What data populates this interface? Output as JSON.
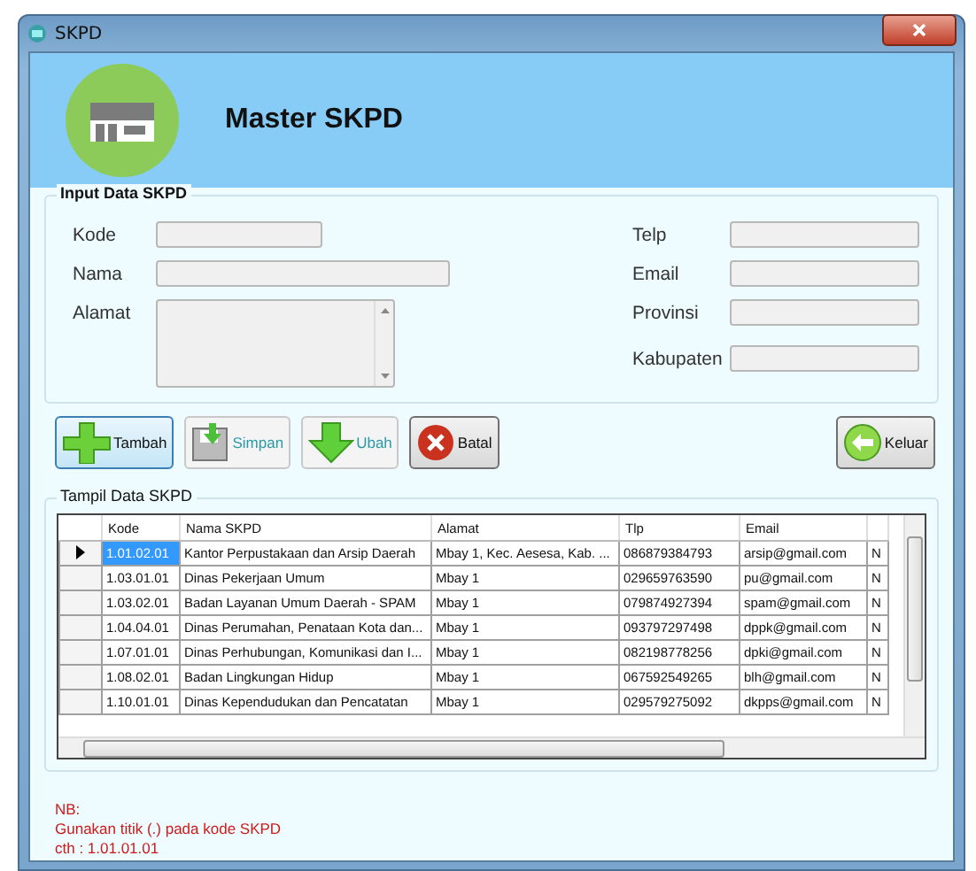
{
  "window": {
    "title": "SKPD"
  },
  "header": {
    "title": "Master SKPD"
  },
  "input_group": {
    "title": "Input Data SKPD",
    "left_fields": [
      {
        "label": "Kode",
        "kind": "short"
      },
      {
        "label": "Nama",
        "kind": "long"
      },
      {
        "label": "Alamat",
        "kind": "multiline"
      }
    ],
    "right_fields": [
      {
        "label": "Telp"
      },
      {
        "label": "Email"
      },
      {
        "label": "Provinsi"
      },
      {
        "label": "Kabupaten"
      }
    ]
  },
  "buttons": [
    {
      "label": "Tambah",
      "kind": "plus",
      "disabled": false,
      "focused": true
    },
    {
      "label": "Simpan",
      "kind": "save",
      "disabled": true,
      "focused": false
    },
    {
      "label": "Ubah",
      "kind": "down",
      "disabled": true,
      "focused": false
    },
    {
      "label": "Batal",
      "kind": "cancel",
      "disabled": false,
      "focused": false
    }
  ],
  "exit_button": {
    "label": "Keluar"
  },
  "table_group": {
    "title": "Tampil Data SKPD",
    "columns": [
      "Kode",
      "Nama SKPD",
      "Alamat",
      "Tlp",
      "Email"
    ],
    "rows": [
      {
        "selected": true,
        "cells": [
          "1.01.02.01",
          "Kantor Perpustakaan dan Arsip Daerah",
          "Mbay 1, Kec. Aesesa, Kab. ...",
          "086879384793",
          "arsip@gmail.com",
          "N"
        ]
      },
      {
        "selected": false,
        "cells": [
          "1.03.01.01",
          "Dinas Pekerjaan Umum",
          "Mbay 1",
          "029659763590",
          "pu@gmail.com",
          "N"
        ]
      },
      {
        "selected": false,
        "cells": [
          "1.03.02.01",
          "Badan Layanan Umum Daerah - SPAM",
          "Mbay 1",
          "079874927394",
          "spam@gmail.com",
          "N"
        ]
      },
      {
        "selected": false,
        "cells": [
          "1.04.04.01",
          "Dinas Perumahan, Penataan Kota dan...",
          "Mbay 1",
          "093797297498",
          "dppk@gmail.com",
          "N"
        ]
      },
      {
        "selected": false,
        "cells": [
          "1.07.01.01",
          "Dinas Perhubungan, Komunikasi dan I...",
          "Mbay 1",
          "082198778256",
          "dpki@gmail.com",
          "N"
        ]
      },
      {
        "selected": false,
        "cells": [
          "1.08.02.01",
          "Badan Lingkungan Hidup",
          "Mbay 1",
          "067592549265",
          "blh@gmail.com",
          "N"
        ]
      },
      {
        "selected": false,
        "cells": [
          "1.10.01.01",
          "Dinas Kependudukan dan Pencatatan",
          "Mbay 1",
          "029579275092",
          "dkpps@gmail.com",
          "N"
        ]
      }
    ]
  },
  "note": [
    "NB:",
    "Gunakan titik (.) pada kode SKPD",
    "cth : 1.01.01.01"
  ]
}
